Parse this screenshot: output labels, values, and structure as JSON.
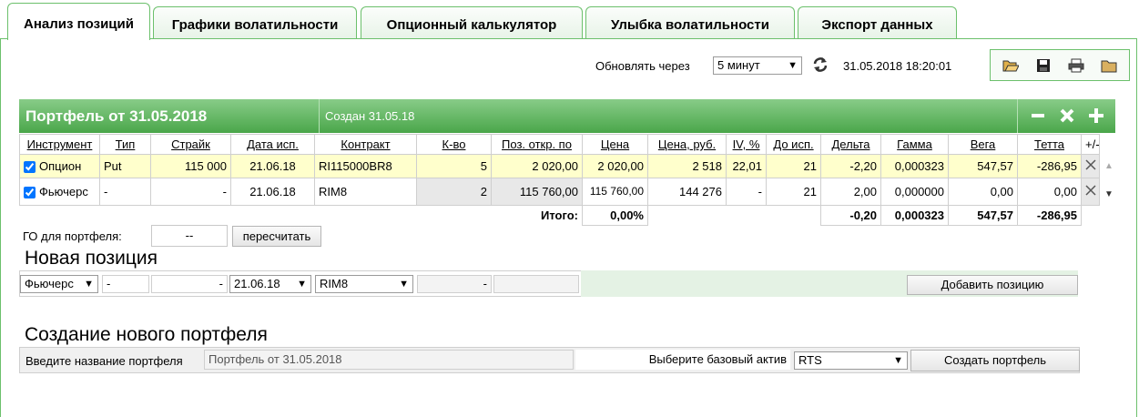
{
  "tabs": [
    {
      "label": "Анализ позиций",
      "active": true
    },
    {
      "label": "Графики волатильности",
      "active": false
    },
    {
      "label": "Опционный калькулятор",
      "active": false
    },
    {
      "label": "Улыбка волатильности",
      "active": false
    },
    {
      "label": "Экспорт данных",
      "active": false
    }
  ],
  "refresh": {
    "label": "Обновлять через",
    "interval": "5 минут",
    "timestamp": "31.05.2018 18:20:01"
  },
  "toolbar_icons": [
    "open-folder-icon",
    "save-icon",
    "print-icon",
    "folder-icon"
  ],
  "portfolio": {
    "title": "Портфель от 31.05.2018",
    "created": "Создан 31.05.18",
    "columns": [
      "Инструмент",
      "Тип",
      "Страйк",
      "Дата исп.",
      "Контракт",
      "К-во",
      "Поз. откр. по",
      "Цена",
      "Цена, руб.",
      "IV, %",
      "До исп.",
      "Дельта",
      "Гамма",
      "Вега",
      "Тетта",
      "+/-"
    ],
    "rows": [
      {
        "instrument": "Опцион",
        "type": "Put",
        "strike": "115 000",
        "date": "21.06.18",
        "contract": "RI115000BR8",
        "qty": "5",
        "open_price": "2 020,00",
        "price": "2 020,00",
        "price_rub": "2 518",
        "iv": "22,01",
        "days": "21",
        "delta": "-2,20",
        "gamma": "0,000323",
        "vega": "547,57",
        "theta": "-286,95"
      },
      {
        "instrument": "Фьючерс",
        "type": "-",
        "strike": "-",
        "date": "21.06.18",
        "contract": "RIM8",
        "qty": "2",
        "open_price": "115 760,00",
        "price": "115 760,00",
        "price_rub": "144 276",
        "iv": "-",
        "days": "21",
        "delta": "2,00",
        "gamma": "0,000000",
        "vega": "0,00",
        "theta": "0,00"
      }
    ],
    "totals": {
      "label": "Итого:",
      "pct": "0,00%",
      "delta": "-0,20",
      "gamma": "0,000323",
      "vega": "547,57",
      "theta": "-286,95"
    }
  },
  "go": {
    "label": "ГО для портфеля:",
    "value": "--",
    "recalc_button": "пересчитать"
  },
  "new_position": {
    "heading": "Новая позиция",
    "instrument": "Фьючерс",
    "type": "-",
    "strike": "-",
    "date": "21.06.18",
    "contract": "RIM8",
    "qty": "-",
    "add_button": "Добавить позицию"
  },
  "new_portfolio": {
    "heading": "Создание нового портфеля",
    "name_label": "Введите название портфеля",
    "name_value": "Портфель от 31.05.2018",
    "asset_label": "Выберите базовый актив",
    "asset_value": "RTS",
    "create_button": "Создать портфель"
  }
}
